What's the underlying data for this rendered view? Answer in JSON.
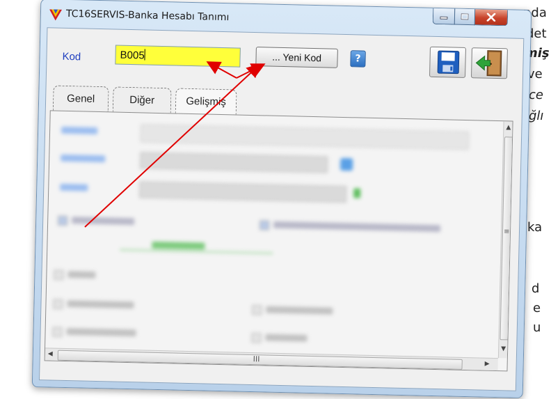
{
  "background_text": [
    "nda",
    "det",
    "miş",
    "ve",
    "ce",
    "ğlı",
    "ka",
    "d",
    "e",
    "u"
  ],
  "window": {
    "title": "TC16SERVIS-Banka Hesabı Tanımı",
    "controls": {
      "minimize_icon": "minimize-icon",
      "maximize_icon": "maximize-icon",
      "close_icon": "close-icon"
    }
  },
  "header": {
    "kod_label": "Kod",
    "kod_value": "B005",
    "yeni_kod_label": "... Yeni Kod",
    "help_label": "?",
    "save_icon": "floppy-disk-icon",
    "exit_icon": "exit-door-icon"
  },
  "tabs": [
    {
      "label": "Genel"
    },
    {
      "label": "Diğer"
    },
    {
      "label": "Gelişmiş",
      "active": true
    }
  ],
  "scrollbar": {
    "hscroll_glyph": "III",
    "vscroll_glyph": "≡"
  },
  "colors": {
    "kod_field": "#ffff3a",
    "annotation_arrow": "#e00000",
    "label_blue": "#1f3fbf"
  }
}
